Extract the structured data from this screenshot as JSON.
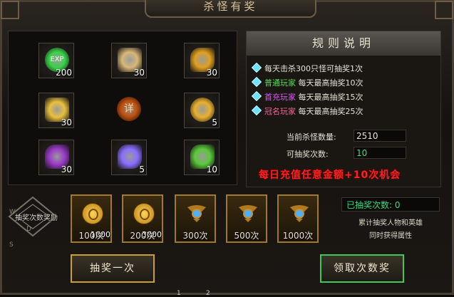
{
  "title": "杀怪有奖",
  "grid": {
    "items": [
      {
        "icon": "exp-orb-icon",
        "count": "200",
        "color": "#3bd34a"
      },
      {
        "icon": "scroll-map-icon",
        "count": "30",
        "color": "#d8b878"
      },
      {
        "icon": "gold-gem-icon",
        "count": "30",
        "color": "#e0a020"
      },
      {
        "icon": "gold-ingot-icon",
        "count": "30",
        "color": "#e8c040"
      },
      {
        "icon": "xiang-orb-icon",
        "count": "",
        "color": "#c05010",
        "glyph": "详"
      },
      {
        "icon": "gold-coin-icon",
        "count": "5",
        "color": "#e8b030"
      },
      {
        "icon": "purple-crystal-icon",
        "count": "30",
        "color": "#9a3cc8"
      },
      {
        "icon": "violet-crystal-icon",
        "count": "5",
        "color": "#8a70ff"
      },
      {
        "icon": "green-stone-icon",
        "count": "10",
        "color": "#5ac83c"
      }
    ]
  },
  "rules": {
    "title": "规则说明",
    "lines": [
      {
        "prefix": "",
        "text": "每天击杀300只怪可抽奖1次"
      },
      {
        "prefix": "普通玩家",
        "text": " 每天最高抽奖10次",
        "cls": "hl-green"
      },
      {
        "prefix": "首充玩家",
        "text": " 每天最高抽奖15次",
        "cls": "hl-purple"
      },
      {
        "prefix": "冠名玩家",
        "text": " 每天最高抽奖25次",
        "cls": "hl-pink"
      }
    ],
    "kill_label": "当前杀怪数量:",
    "kill_value": "2510",
    "draw_label": "可抽奖次数:",
    "draw_value": "10",
    "promo": "每日充值任意金额+10次机会"
  },
  "award": {
    "label": "抽奖次数奖励",
    "boxes": [
      {
        "type": "coin",
        "num": "1000",
        "label": "100次"
      },
      {
        "type": "coin",
        "num": "3000",
        "label": "200次"
      },
      {
        "type": "emblem",
        "num": "",
        "label": "300次"
      },
      {
        "type": "emblem",
        "num": "",
        "label": "500次"
      },
      {
        "type": "emblem",
        "num": "",
        "label": "1000次"
      }
    ]
  },
  "drawn": {
    "label": "已抽奖次数:",
    "value": "0"
  },
  "drawn_note": [
    "累计抽奖人物和英雄",
    "同时获得属性"
  ],
  "buttons": {
    "draw": "抽奖一次",
    "claim": "领取次数奖"
  },
  "side_letters": {
    "w": "W",
    "d": "D",
    "s": "S"
  },
  "page_numbers": [
    "1",
    "2"
  ]
}
